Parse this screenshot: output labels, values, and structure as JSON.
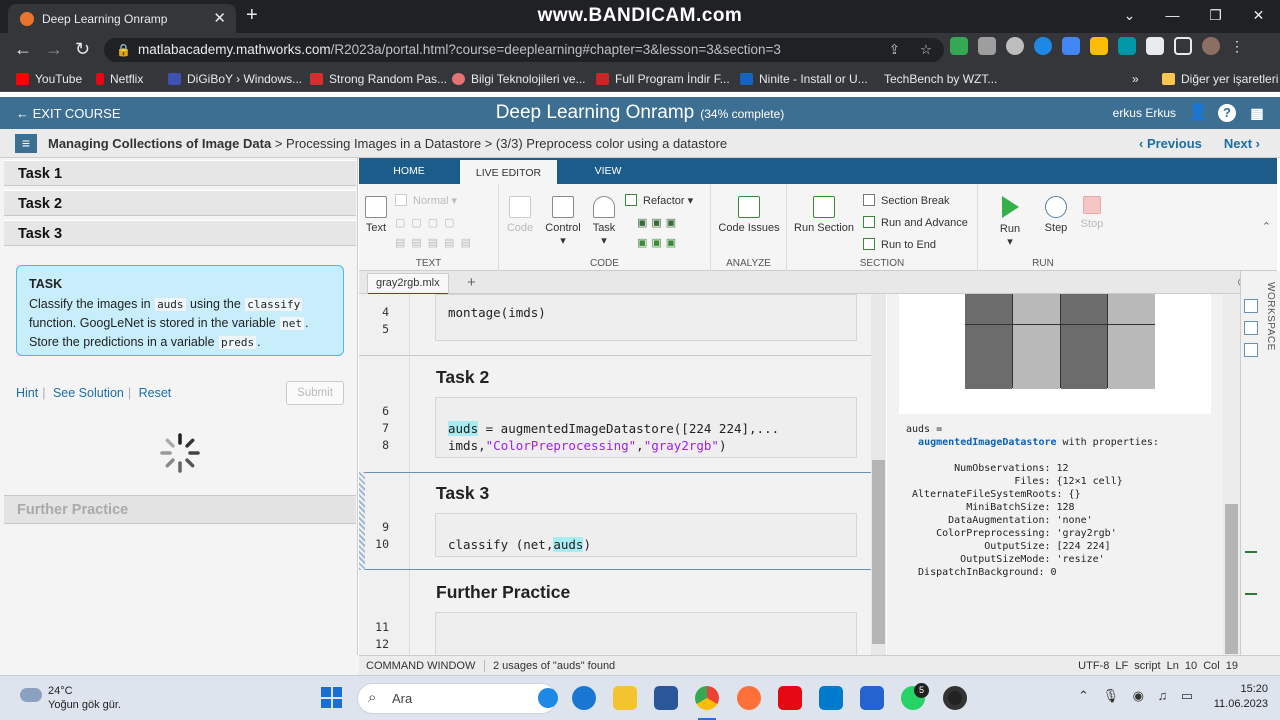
{
  "browser": {
    "tab_title": "Deep Learning Onramp",
    "recorder_watermark": "www.BANDICAM.com",
    "url_host": "matlabacademy.mathworks.com",
    "url_path": "/R2023a/portal.html?course=deeplearning#chapter=3&lesson=3&section=3",
    "bookmarks": [
      "YouTube",
      "Netflix",
      "DiGiBoY › Windows...",
      "Strong Random Pas...",
      "Bilgi Teknolojileri ve...",
      "Full Program İndir F...",
      "Ninite - Install or U...",
      "TechBench by WZT..."
    ],
    "bookmarks_more": "»",
    "other_bookmarks": "Diğer yer işaretleri"
  },
  "course": {
    "exit_label": "← EXIT COURSE",
    "title": "Deep Learning Onramp",
    "progress": "(34% complete)",
    "user_name": "erkus Erkus",
    "breadcrumb_bold": "Managing Collections of Image Data",
    "breadcrumb_rest": " > Processing Images in a Datastore > (3/3) Preprocess color using a datastore",
    "previous": "‹ Previous",
    "next": "Next ›"
  },
  "tasks": {
    "task1": "Task 1",
    "task2": "Task 2",
    "task3": "Task 3",
    "box_heading": "TASK",
    "box_t1": "Classify the images in ",
    "box_c1": "auds",
    "box_t2": " using the ",
    "box_c2": "classify",
    "box_t3": "function. GoogLeNet is stored in the variable ",
    "box_c3": "net",
    "box_t4": ".",
    "box_t5": "Store the predictions in a variable ",
    "box_c4": "preds",
    "box_t6": ".",
    "hint": "Hint",
    "see_solution": "See Solution",
    "reset": "Reset",
    "submit": "Submit",
    "further_practice": "Further Practice"
  },
  "ribbon": {
    "tabs": [
      "HOME",
      "LIVE EDITOR",
      "VIEW"
    ],
    "text_group": {
      "text_btn": "Text",
      "style": "Normal",
      "label": "TEXT"
    },
    "code_group": {
      "code": "Code",
      "control": "Control",
      "task": "Task",
      "refactor": "Refactor",
      "label": "CODE"
    },
    "analyze_group": {
      "code_issues": "Code Issues",
      "label": "ANALYZE"
    },
    "section_group": {
      "run_section": "Run Section",
      "section_break": "Section Break",
      "run_and_advance": "Run and Advance",
      "run_to_end": "Run to End",
      "label": "SECTION"
    },
    "run_group": {
      "run": "Run",
      "step": "Step",
      "stop": "Stop",
      "label": "RUN"
    }
  },
  "editor": {
    "file_tab": "gray2rgb.mlx",
    "add_tab": "+",
    "line_numbers": [
      "4",
      "5",
      "6",
      "7",
      "8",
      "9",
      "10",
      "11",
      "12"
    ],
    "code_montage": "montage(imds)",
    "section_task2": "Task 2",
    "l7_var": "auds",
    "l7_rest": " = augmentedImageDatastore([224 224],...",
    "l8_a": "imds,",
    "l8_s1": "\"ColorPreprocessing\"",
    "l8_b": ",",
    "l8_s2": "\"gray2rgb\"",
    "l8_c": ")",
    "section_task3": "Task 3",
    "l10_a": "classify (net,",
    "l10_var": "auds",
    "l10_c": ")",
    "section_further": "Further Practice"
  },
  "output": {
    "var_line": "auds =",
    "class_name": "augmentedImageDatastore",
    "class_suffix": " with properties:",
    "properties": "        NumObservations: 12\n                  Files: {12×1 cell}\n AlternateFileSystemRoots: {}\n          MiniBatchSize: 128\n       DataAugmentation: 'none'\n     ColorPreprocessing: 'gray2rgb'\n             OutputSize: [224 224]\n         OutputSizeMode: 'resize'\n  DispatchInBackground: 0",
    "workspace_label": "WORKSPACE"
  },
  "statusbar": {
    "command_window": "COMMAND WINDOW",
    "usages": "2 usages of \"auds\" found",
    "encoding_info": "UTF-8   LF   script   Ln  10  Col  19"
  },
  "taskbar": {
    "temperature": "24°C",
    "weather": "Yoğun gök gür.",
    "search": "Ara",
    "whatsapp_badge": "5",
    "time": "15:20",
    "date": "11.06.2023"
  },
  "colors": {
    "course_header": "#3c6f91",
    "matlab_blue": "#1c5c8a",
    "task_box": "#c9eefb",
    "highlight": "#a6ecf2"
  }
}
